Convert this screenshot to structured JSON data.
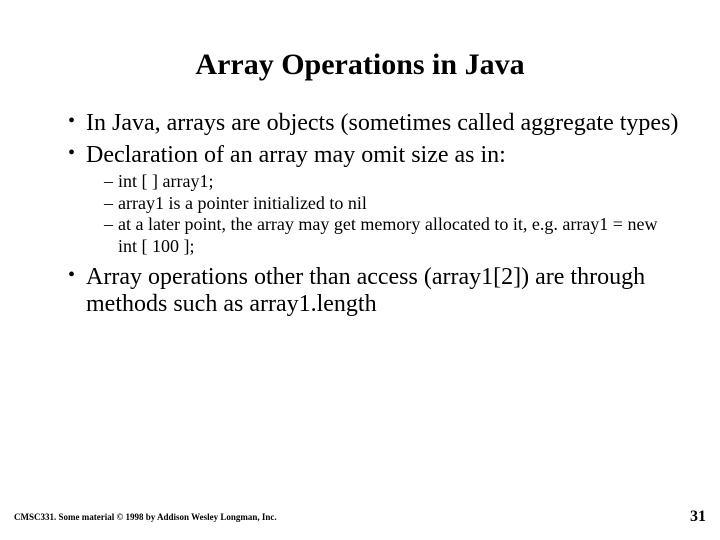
{
  "title": "Array Operations in Java",
  "bullets": {
    "b1": "In Java, arrays are objects (sometimes called aggregate types)",
    "b2": "Declaration of an array may omit size as in:",
    "b3": "Array operations other than access (array1[2]) are through methods such as array1.length"
  },
  "subbullets": {
    "s1": "int [ ] array1;",
    "s2": "array1 is a pointer initialized to nil",
    "s3": "at a later point, the array may get memory allocated to it, e.g. array1 = new int [ 100 ];"
  },
  "footer": {
    "left": "CMSC331.  Some material © 1998 by Addison Wesley Longman, Inc.",
    "page": "31"
  }
}
